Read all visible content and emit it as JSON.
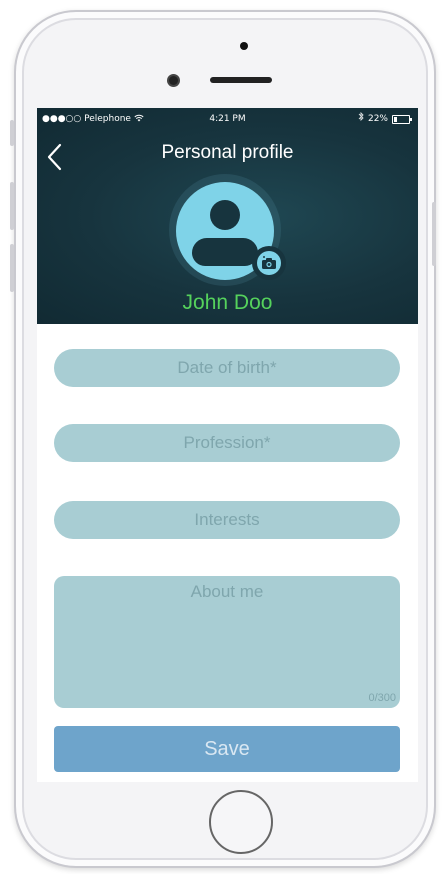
{
  "status_bar": {
    "carrier": "●●●○○ Pelephone",
    "time": "4:21 PM",
    "battery": "22%"
  },
  "header": {
    "title": "Personal profile",
    "user_name": "John Doo"
  },
  "form": {
    "dob_placeholder": "Date of birth*",
    "profession_placeholder": "Profession*",
    "interests_placeholder": "Interests",
    "about_placeholder": "About me",
    "about_counter": "0/300",
    "save_label": "Save"
  },
  "colors": {
    "header_bg": "#17343e",
    "accent_cyan": "#7fd3e8",
    "name_green": "#55d25c",
    "field_bg": "#a8cdd3",
    "save_bg": "#6ea4cb"
  },
  "icons": [
    "back-chevron-icon",
    "wifi-icon",
    "bluetooth-icon",
    "battery-icon",
    "avatar-person-icon",
    "camera-icon"
  ]
}
